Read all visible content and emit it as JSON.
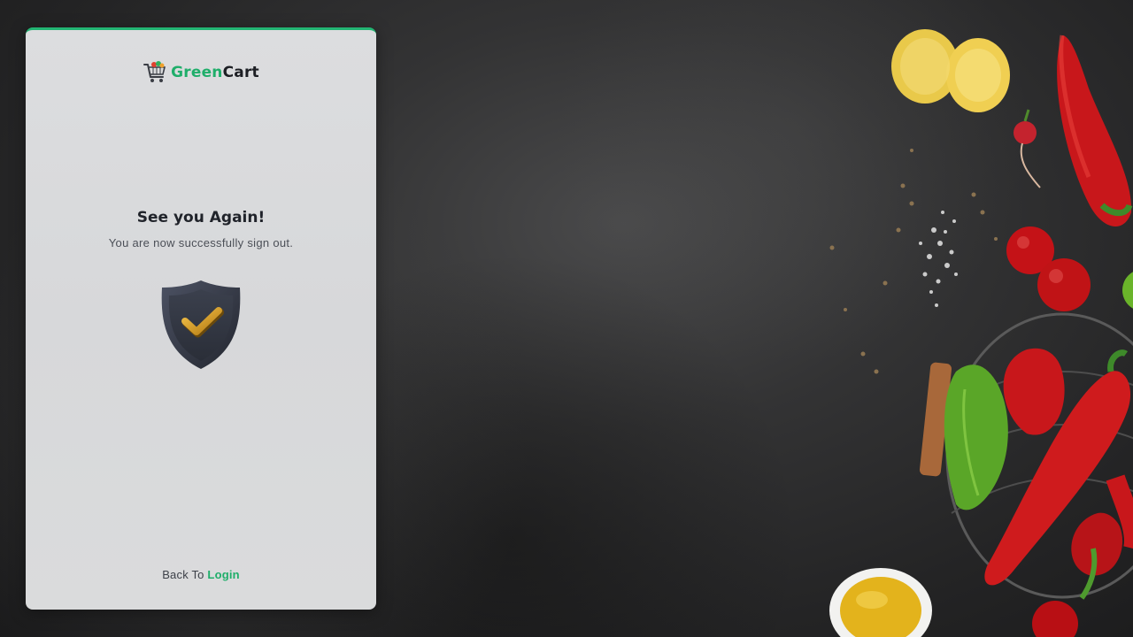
{
  "brand": {
    "name_part1": "Green",
    "name_part2": "Cart",
    "logo_icon": "shopping-cart-icon",
    "accent_color": "#1fae6a"
  },
  "signout": {
    "title": "See you Again!",
    "message": "You are now successfully sign out.",
    "status_icon": "shield-check-icon"
  },
  "footer": {
    "back_prefix": "Back To",
    "login_label": "Login"
  },
  "background": {
    "image": "vegetables-on-dark-slate"
  }
}
